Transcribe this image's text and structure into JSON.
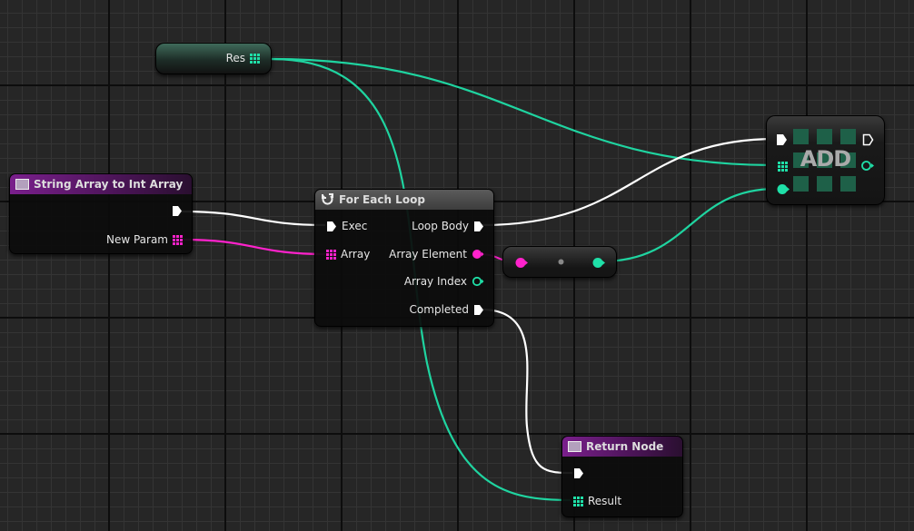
{
  "colors": {
    "exec": "#ffffff",
    "array_string": "#ff22cc",
    "integer": "#1fe0a8",
    "function_header": "#7a1f8c"
  },
  "nodes": {
    "res_variable": {
      "label": "Res"
    },
    "string_array_to_int_array": {
      "title": "String Array to Int Array",
      "outputs": [
        "",
        "New Param"
      ]
    },
    "for_each_loop": {
      "title": "For Each Loop",
      "icon": "loop-icon",
      "inputs": [
        "Exec",
        "Array"
      ],
      "outputs": [
        "Loop Body",
        "Array Element",
        "Array Index",
        "Completed"
      ]
    },
    "conversion": {},
    "add": {
      "title": "ADD"
    },
    "return_node": {
      "title": "Return Node",
      "inputs": [
        "",
        "Result"
      ]
    }
  }
}
